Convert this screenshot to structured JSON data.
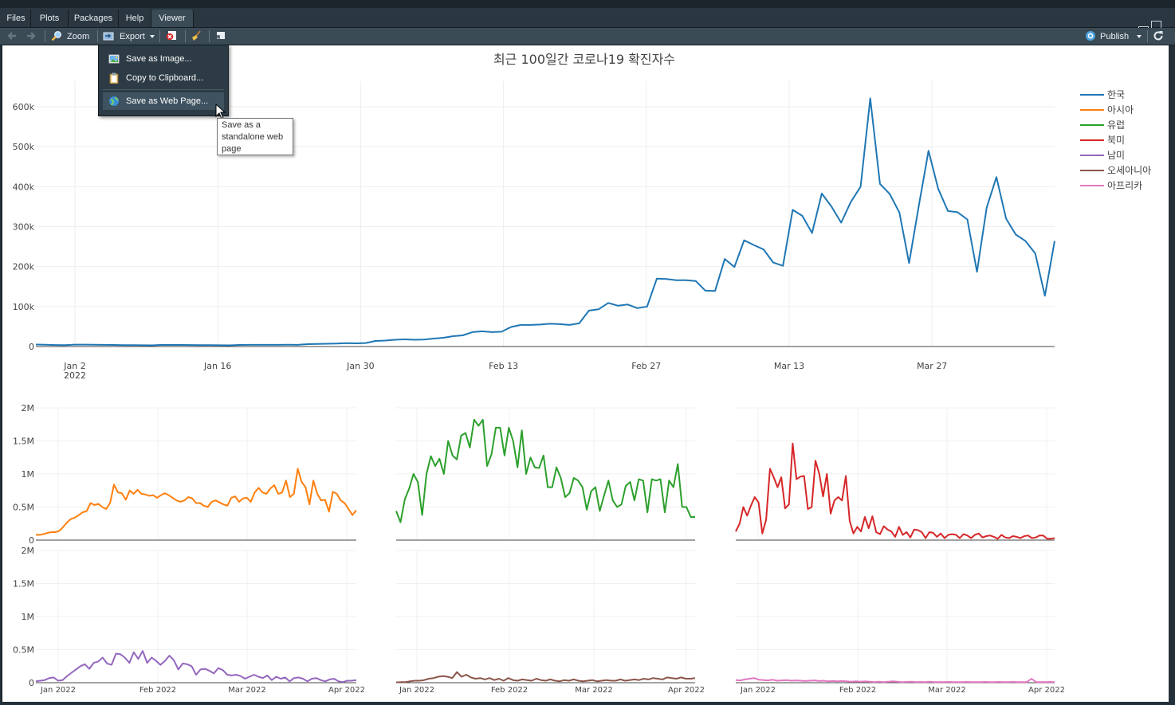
{
  "tabs": [
    {
      "label": "Files",
      "active": false
    },
    {
      "label": "Plots",
      "active": false
    },
    {
      "label": "Packages",
      "active": false
    },
    {
      "label": "Help",
      "active": false
    },
    {
      "label": "Viewer",
      "active": true
    }
  ],
  "toolbar": {
    "zoom_label": "Zoom",
    "export_label": "Export",
    "publish_label": "Publish",
    "icons": [
      "back-arrow-icon",
      "forward-arrow-icon",
      "zoom-icon",
      "export-icon",
      "remove-viewer-icon",
      "broom-icon",
      "show-in-window-icon",
      "publish-icon",
      "refresh-icon"
    ]
  },
  "export_menu": {
    "items": [
      {
        "label": "Save as Image...",
        "icon": "image-icon"
      },
      {
        "label": "Copy to Clipboard...",
        "icon": "clipboard-icon"
      },
      {
        "label": "Save as Web Page...",
        "icon": "globe-icon",
        "highlighted": true
      }
    ]
  },
  "tooltip": {
    "lines": [
      "Save as a",
      "standalone web",
      "page"
    ]
  },
  "chart_data": [
    {
      "type": "line",
      "title": "최근 100일간 코로나19 확진자수",
      "x_start": "2021-12-25",
      "x_ticks": [
        "Jan 2\n2022",
        "Jan 16",
        "Jan 30",
        "Feb 13",
        "Feb 27",
        "Mar 13",
        "Mar 27"
      ],
      "y_ticks": [
        "0",
        "100k",
        "200k",
        "300k",
        "400k",
        "500k",
        "600k"
      ],
      "ylim": [
        0,
        600000
      ],
      "legend": {
        "placement": "right",
        "entries": [
          {
            "name": "한국",
            "color": "#1f77b4"
          },
          {
            "name": "아시아",
            "color": "#ff7f0e"
          },
          {
            "name": "유럽",
            "color": "#2ca02c"
          },
          {
            "name": "북미",
            "color": "#d62728"
          },
          {
            "name": "남미",
            "color": "#9467bd"
          },
          {
            "name": "오세아니아",
            "color": "#8c564b"
          },
          {
            "name": "아프리카",
            "color": "#e377c2"
          }
        ]
      },
      "series": [
        {
          "name": "한국",
          "color": "#1f77b4",
          "values": [
            5000,
            4500,
            3800,
            3300,
            4800,
            4700,
            4300,
            4100,
            3900,
            3600,
            3300,
            3100,
            2900,
            4100,
            4000,
            3900,
            3800,
            3600,
            3400,
            3200,
            3000,
            4000,
            4100,
            4100,
            4200,
            4200,
            4300,
            4200,
            6000,
            6500,
            7000,
            7600,
            8500,
            8000,
            8700,
            14000,
            15000,
            17000,
            18000,
            17000,
            17500,
            20000,
            22000,
            26000,
            28000,
            36000,
            38000,
            36000,
            37000,
            49000,
            54000,
            54000,
            55000,
            57000,
            56000,
            54000,
            58000,
            90000,
            93000,
            109000,
            102000,
            105000,
            96000,
            100000,
            170000,
            169000,
            166000,
            166000,
            164000,
            140000,
            139000,
            219000,
            199000,
            266000,
            254000,
            243000,
            210000,
            202000,
            342000,
            327000,
            284000,
            383000,
            350000,
            310000,
            362000,
            400000,
            621000,
            407000,
            382000,
            335000,
            209000,
            352000,
            490000,
            395000,
            339000,
            336000,
            318000,
            187000,
            348000,
            424000,
            320000,
            280000,
            264000,
            233000,
            127000,
            264000
          ]
        }
      ]
    },
    {
      "type": "line",
      "x_ticks": [
        "Jan 2022",
        "Feb 2022",
        "Mar 2022",
        "Apr 2022"
      ],
      "y_ticks": [
        "0",
        "0.5M",
        "1M",
        "1.5M",
        "2M"
      ],
      "ylim": [
        0,
        2000000
      ],
      "panels": [
        {
          "name": "아시아",
          "color": "#ff7f0e",
          "values": [
            80000,
            80000,
            90000,
            110000,
            120000,
            120000,
            140000,
            200000,
            270000,
            320000,
            340000,
            380000,
            420000,
            440000,
            560000,
            530000,
            550000,
            500000,
            470000,
            560000,
            840000,
            720000,
            710000,
            610000,
            750000,
            700000,
            760000,
            700000,
            690000,
            670000,
            680000,
            640000,
            680000,
            710000,
            680000,
            640000,
            600000,
            580000,
            600000,
            650000,
            630000,
            560000,
            560000,
            520000,
            500000,
            580000,
            600000,
            570000,
            540000,
            520000,
            640000,
            660000,
            580000,
            630000,
            640000,
            580000,
            720000,
            790000,
            720000,
            700000,
            780000,
            830000,
            700000,
            720000,
            900000,
            650000,
            700000,
            1080000,
            880000,
            800000,
            540000,
            900000,
            700000,
            600000,
            610000,
            430000,
            730000,
            700000,
            600000,
            560000,
            470000,
            380000,
            450000
          ]
        },
        {
          "name": "유럽",
          "color": "#2ca02c",
          "values": [
            440000,
            270000,
            620000,
            780000,
            1000000,
            880000,
            380000,
            1000000,
            1270000,
            1120000,
            1230000,
            1000000,
            1500000,
            1280000,
            1220000,
            1580000,
            1620000,
            1400000,
            1820000,
            1730000,
            1820000,
            1120000,
            1300000,
            1700000,
            1700000,
            1280000,
            1700000,
            1500000,
            1100000,
            1660000,
            1000000,
            1250000,
            1100000,
            1090000,
            1280000,
            800000,
            800000,
            1100000,
            940000,
            650000,
            710000,
            940000,
            900000,
            800000,
            460000,
            740000,
            800000,
            440000,
            680000,
            900000,
            600000,
            500000,
            540000,
            820000,
            880000,
            600000,
            920000,
            900000,
            420000,
            920000,
            900000,
            920000,
            420000,
            900000,
            800000,
            1150000,
            500000,
            500000,
            350000,
            350000
          ]
        },
        {
          "name": "북미",
          "color": "#d62728",
          "values": [
            130000,
            250000,
            500000,
            370000,
            520000,
            650000,
            570000,
            100000,
            310000,
            1080000,
            950000,
            800000,
            950000,
            480000,
            540000,
            1460000,
            920000,
            960000,
            970000,
            470000,
            500000,
            1200000,
            1000000,
            660000,
            1000000,
            400000,
            600000,
            650000,
            600000,
            970000,
            290000,
            100000,
            200000,
            130000,
            350000,
            180000,
            360000,
            120000,
            90000,
            210000,
            160000,
            130000,
            50000,
            200000,
            80000,
            120000,
            40000,
            160000,
            150000,
            120000,
            30000,
            120000,
            110000,
            50000,
            100000,
            30000,
            80000,
            90000,
            80000,
            30000,
            90000,
            70000,
            30000,
            80000,
            100000,
            40000,
            60000,
            70000,
            50000,
            20000,
            80000,
            40000,
            30000,
            60000,
            50000,
            30000,
            60000,
            70000,
            30000,
            40000,
            70000,
            70000,
            20000,
            20000,
            30000
          ]
        },
        {
          "name": "남미",
          "color": "#9467bd",
          "values": [
            20000,
            30000,
            40000,
            70000,
            80000,
            30000,
            40000,
            100000,
            150000,
            200000,
            250000,
            280000,
            210000,
            300000,
            320000,
            380000,
            290000,
            270000,
            440000,
            430000,
            380000,
            300000,
            460000,
            360000,
            480000,
            300000,
            380000,
            330000,
            270000,
            330000,
            410000,
            340000,
            200000,
            290000,
            280000,
            250000,
            120000,
            200000,
            210000,
            180000,
            140000,
            220000,
            190000,
            120000,
            110000,
            120000,
            100000,
            60000,
            90000,
            120000,
            90000,
            70000,
            110000,
            40000,
            90000,
            60000,
            80000,
            20000,
            70000,
            80000,
            60000,
            20000,
            60000,
            70000,
            40000,
            20000,
            50000,
            60000,
            20000,
            10000,
            30000,
            30000,
            40000
          ]
        },
        {
          "name": "오세아니아",
          "color": "#8c564b",
          "values": [
            5000,
            8000,
            10000,
            20000,
            30000,
            30000,
            40000,
            60000,
            70000,
            90000,
            100000,
            90000,
            70000,
            160000,
            90000,
            120000,
            80000,
            60000,
            70000,
            50000,
            70000,
            40000,
            60000,
            30000,
            70000,
            40000,
            30000,
            50000,
            40000,
            30000,
            60000,
            40000,
            30000,
            50000,
            30000,
            20000,
            40000,
            30000,
            50000,
            30000,
            20000,
            30000,
            40000,
            20000,
            30000,
            40000,
            30000,
            30000,
            50000,
            30000,
            40000,
            50000,
            40000,
            60000,
            50000,
            70000,
            60000,
            50000,
            80000,
            70000,
            60000,
            80000,
            60000,
            60000,
            70000
          ]
        },
        {
          "name": "아프리카",
          "color": "#e377c2",
          "values": [
            40000,
            35000,
            50000,
            60000,
            70000,
            45000,
            40000,
            35000,
            45000,
            30000,
            35000,
            40000,
            30000,
            35000,
            30000,
            25000,
            30000,
            35000,
            25000,
            30000,
            20000,
            25000,
            20000,
            25000,
            20000,
            15000,
            20000,
            15000,
            20000,
            15000,
            10000,
            15000,
            10000,
            15000,
            20000,
            15000,
            10000,
            12000,
            15000,
            10000,
            12000,
            10000,
            15000,
            10000,
            8000,
            10000,
            12000,
            10000,
            8000,
            10000,
            12000,
            10000,
            8000,
            10000,
            12000,
            8000,
            10000,
            12000,
            8000,
            10000,
            12000,
            10000,
            8000,
            10000,
            60000,
            10000,
            8000,
            10000,
            12000,
            10000
          ]
        }
      ]
    }
  ]
}
